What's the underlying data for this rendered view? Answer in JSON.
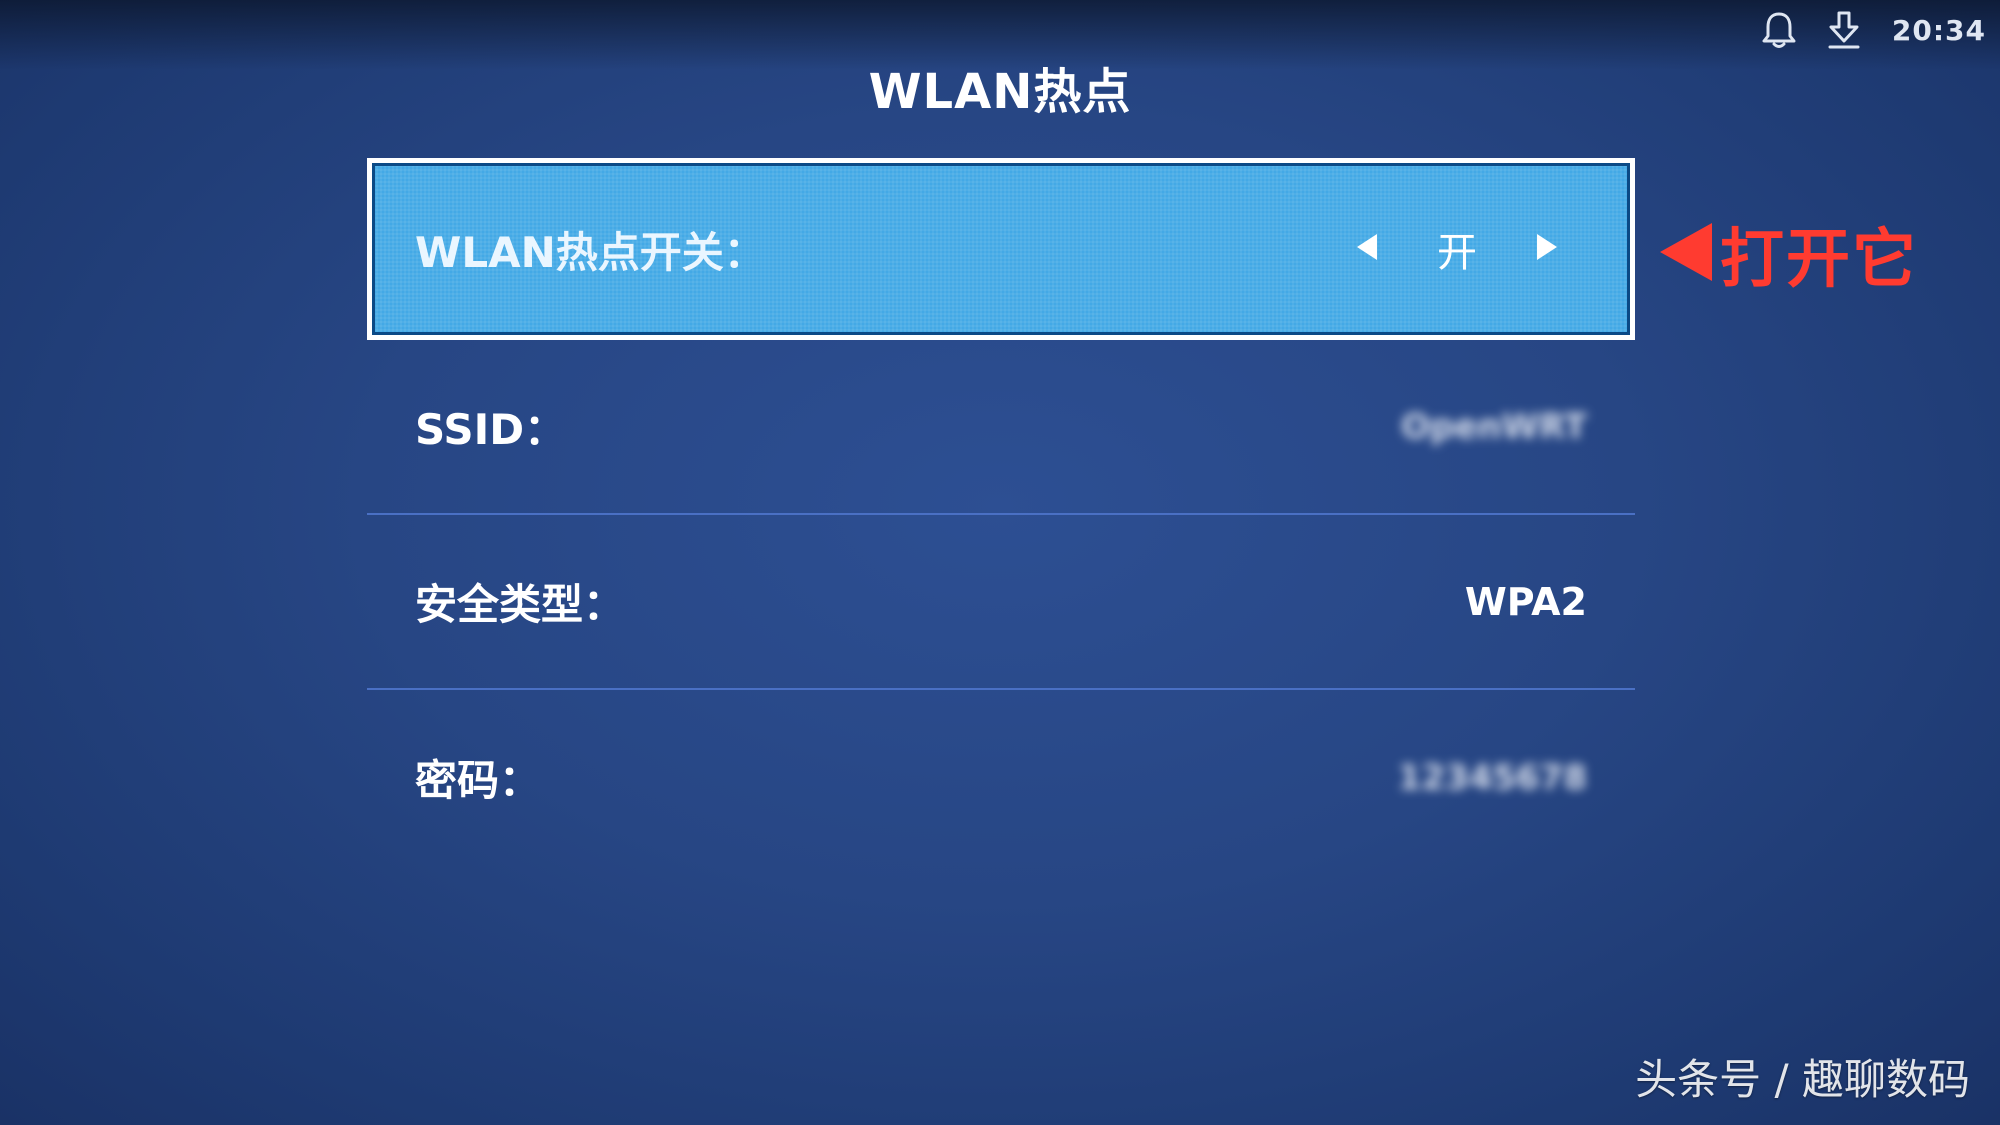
{
  "status_bar": {
    "notification_icon": "bell-icon",
    "download_icon": "download-icon",
    "time": "20:34"
  },
  "page": {
    "title": "WLAN热点"
  },
  "settings": {
    "hotspot_switch": {
      "label": "WLAN热点开关：",
      "value": "开",
      "left_icon": "triangle-left-icon",
      "right_icon": "triangle-right-icon"
    },
    "ssid": {
      "label": "SSID：",
      "value": "OpenWRT"
    },
    "security_type": {
      "label": "安全类型：",
      "value": "WPA2"
    },
    "password": {
      "label": "密码：",
      "value": "12345678"
    }
  },
  "annotation": {
    "text": "打开它",
    "color": "#ff3b30",
    "icon": "red-arrow-left-icon"
  },
  "watermark": {
    "text": "头条号 / 趣聊数码"
  },
  "colors": {
    "background": "#274684",
    "selected_row": "#43a9e6",
    "divider": "#4a70c4"
  }
}
